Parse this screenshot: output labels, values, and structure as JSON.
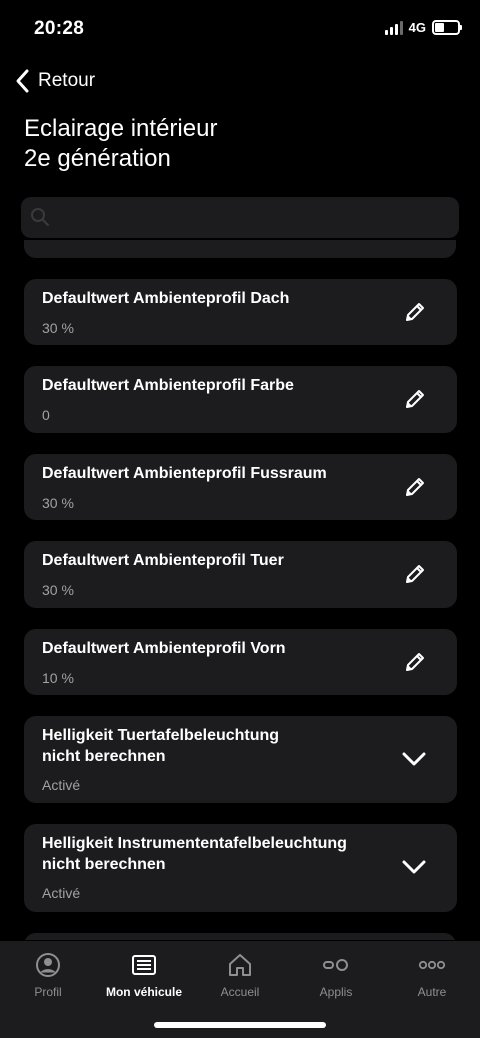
{
  "status": {
    "time": "20:28",
    "network": "4G",
    "battery_level": 0.4
  },
  "nav": {
    "back_label": "Retour"
  },
  "page": {
    "title_line1": "Eclairage intérieur",
    "title_line2": "2e génération"
  },
  "search": {
    "placeholder": ""
  },
  "items": [
    {
      "title": "Defaultwert Ambienteprofil Dach",
      "value": "30 %",
      "action": "edit-icon"
    },
    {
      "title": "Defaultwert Ambienteprofil Farbe",
      "value": "0",
      "action": "edit-icon"
    },
    {
      "title": "Defaultwert Ambienteprofil Fussraum",
      "value": "30 %",
      "action": "edit-icon"
    },
    {
      "title": "Defaultwert Ambienteprofil Tuer",
      "value": "30 %",
      "action": "edit-icon"
    },
    {
      "title": "Defaultwert Ambienteprofil Vorn",
      "value": "10 %",
      "action": "edit-icon"
    },
    {
      "title_line1": "Helligkeit Tuertafelbeleuchtung",
      "title_line2": "nicht berechnen",
      "value": "Activé",
      "action": "chevron-down-icon"
    },
    {
      "title_line1": "Helligkeit Instrumententafelbeleuchtung",
      "title_line2": "nicht berechnen",
      "value": "Activé",
      "action": "chevron-down-icon"
    }
  ],
  "tabbar": {
    "tabs": [
      {
        "label": "Profil",
        "icon": "profile-icon",
        "active": false
      },
      {
        "label": "Mon véhicule",
        "icon": "vehicle-list-icon",
        "active": true
      },
      {
        "label": "Accueil",
        "icon": "home-icon",
        "active": false
      },
      {
        "label": "Applis",
        "icon": "apps-toggle-icon",
        "active": false
      },
      {
        "label": "Autre",
        "icon": "more-icon",
        "active": false
      }
    ]
  },
  "colors": {
    "background": "#000000",
    "card": "#1c1c1e",
    "secondary_text": "#a1a1a6",
    "inactive_tab": "#8e8e93"
  }
}
